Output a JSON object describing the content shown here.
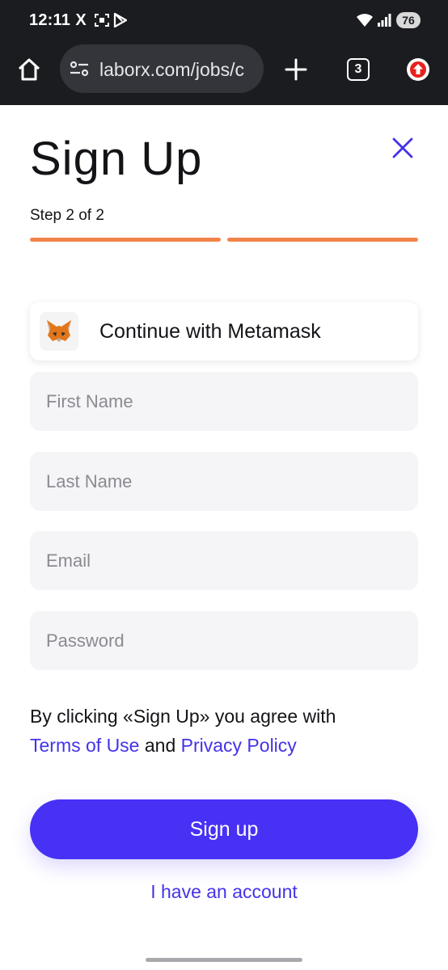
{
  "status_bar": {
    "time": "12:11",
    "x_icon": "X",
    "battery": "76"
  },
  "browser": {
    "url": "laborx.com/jobs/c",
    "tab_count": "3"
  },
  "signup": {
    "title": "Sign Up",
    "step": "Step 2 of 2",
    "progress": {
      "current_step": 2,
      "total_steps": 2,
      "color": "#f2844a"
    },
    "metamask_label": "Continue with Metamask",
    "fields": {
      "first_name_placeholder": "First Name",
      "last_name_placeholder": "Last Name",
      "email_placeholder": "Email",
      "password_placeholder": "Password"
    },
    "terms_prefix": "By clicking «Sign Up» you agree with",
    "terms_link": "Terms of Use",
    "terms_and": "and",
    "privacy_link": "Privacy Policy",
    "submit_label": "Sign up",
    "account_link": "I have an account"
  },
  "colors": {
    "accent": "#4731f4",
    "link": "#4433e8",
    "progress": "#f2844a",
    "chrome_bg": "#1b1c20"
  },
  "icons": [
    "home-icon",
    "site-settings-icon",
    "plus-icon",
    "tab-switcher-icon",
    "update-icon",
    "close-icon",
    "metamask-fox-icon",
    "wifi-icon",
    "signal-icon"
  ]
}
